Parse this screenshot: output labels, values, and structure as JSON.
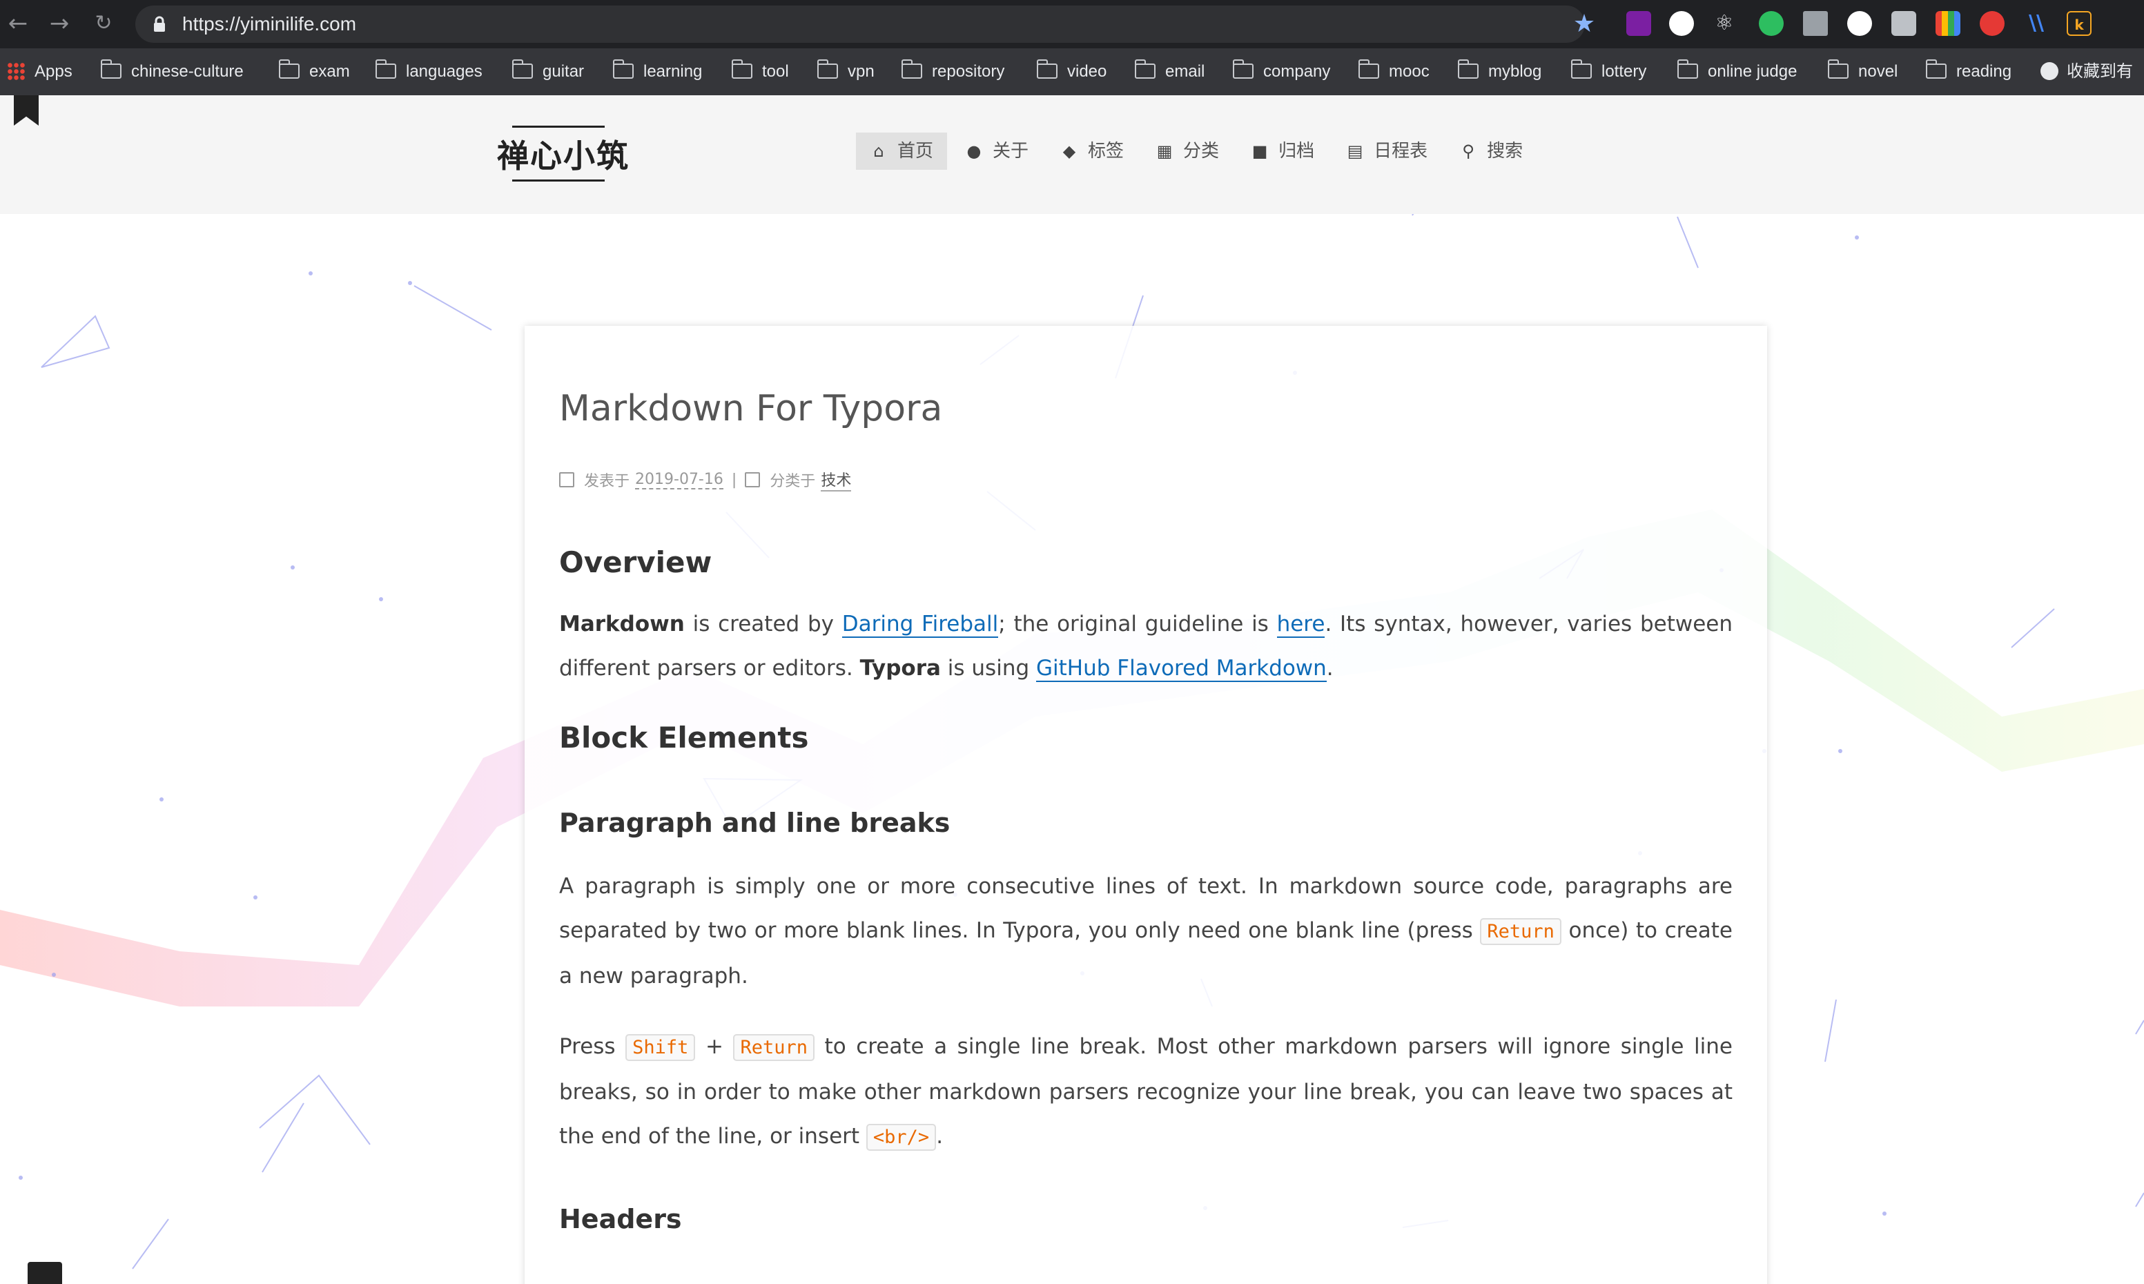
{
  "browser": {
    "url": "https://yiminilife.com",
    "bookmarks": [
      "Apps",
      "chinese-culture",
      "exam",
      "languages",
      "guitar",
      "learning",
      "tool",
      "vpn",
      "repository",
      "video",
      "email",
      "company",
      "mooc",
      "myblog",
      "lottery",
      "online judge",
      "novel",
      "reading",
      "收藏到有"
    ]
  },
  "site": {
    "title": "禅心小筑",
    "menu": [
      {
        "label": "首页",
        "icon": "home-icon"
      },
      {
        "label": "关于",
        "icon": "user-icon"
      },
      {
        "label": "标签",
        "icon": "tags-icon"
      },
      {
        "label": "分类",
        "icon": "grid-icon"
      },
      {
        "label": "归档",
        "icon": "archive-icon"
      },
      {
        "label": "日程表",
        "icon": "calendar-icon"
      },
      {
        "label": "搜索",
        "icon": "search-icon"
      }
    ]
  },
  "post": {
    "title": "Markdown For Typora",
    "meta": {
      "posted_label": "发表于",
      "date": "2019-07-16",
      "category_label": "分类于",
      "category": "技术"
    },
    "overview": {
      "heading": "Overview",
      "s1": "Markdown",
      "s2": " is created by ",
      "link1": "Daring Fireball",
      "s3": "; the original guideline is ",
      "link2": "here",
      "s4": ". Its syntax, however, varies between different parsers or editors. ",
      "s5": "Typora",
      "s6": " is using ",
      "link3": "GitHub Flavored Markdown",
      "s7": "."
    },
    "block_heading": "Block Elements",
    "paragraph_section": {
      "heading": "Paragraph and line breaks",
      "p1a": "A paragraph is simply one or more consecutive lines of text. In markdown source code, paragraphs are separated by two or more blank lines. In Typora, you only need one blank line (press ",
      "p1code": "Return",
      "p1b": " once) to create a new paragraph.",
      "p2a": "Press ",
      "p2code1": "Shift",
      "p2b": " + ",
      "p2code2": "Return",
      "p2c": " to create a single line break. Most other markdown parsers will ignore single line breaks, so in order to make other markdown parsers recognize your line break, you can leave two spaces at the end of the line, or insert ",
      "p2code3": "<br/>",
      "p2d": "."
    },
    "headers_heading": "Headers"
  },
  "colors": {
    "chrome_dark": "#202124",
    "bookmarks_bar": "#35363a",
    "header_bg": "#f5f5f5",
    "link": "#0e6bb8",
    "code": "#e96900"
  }
}
